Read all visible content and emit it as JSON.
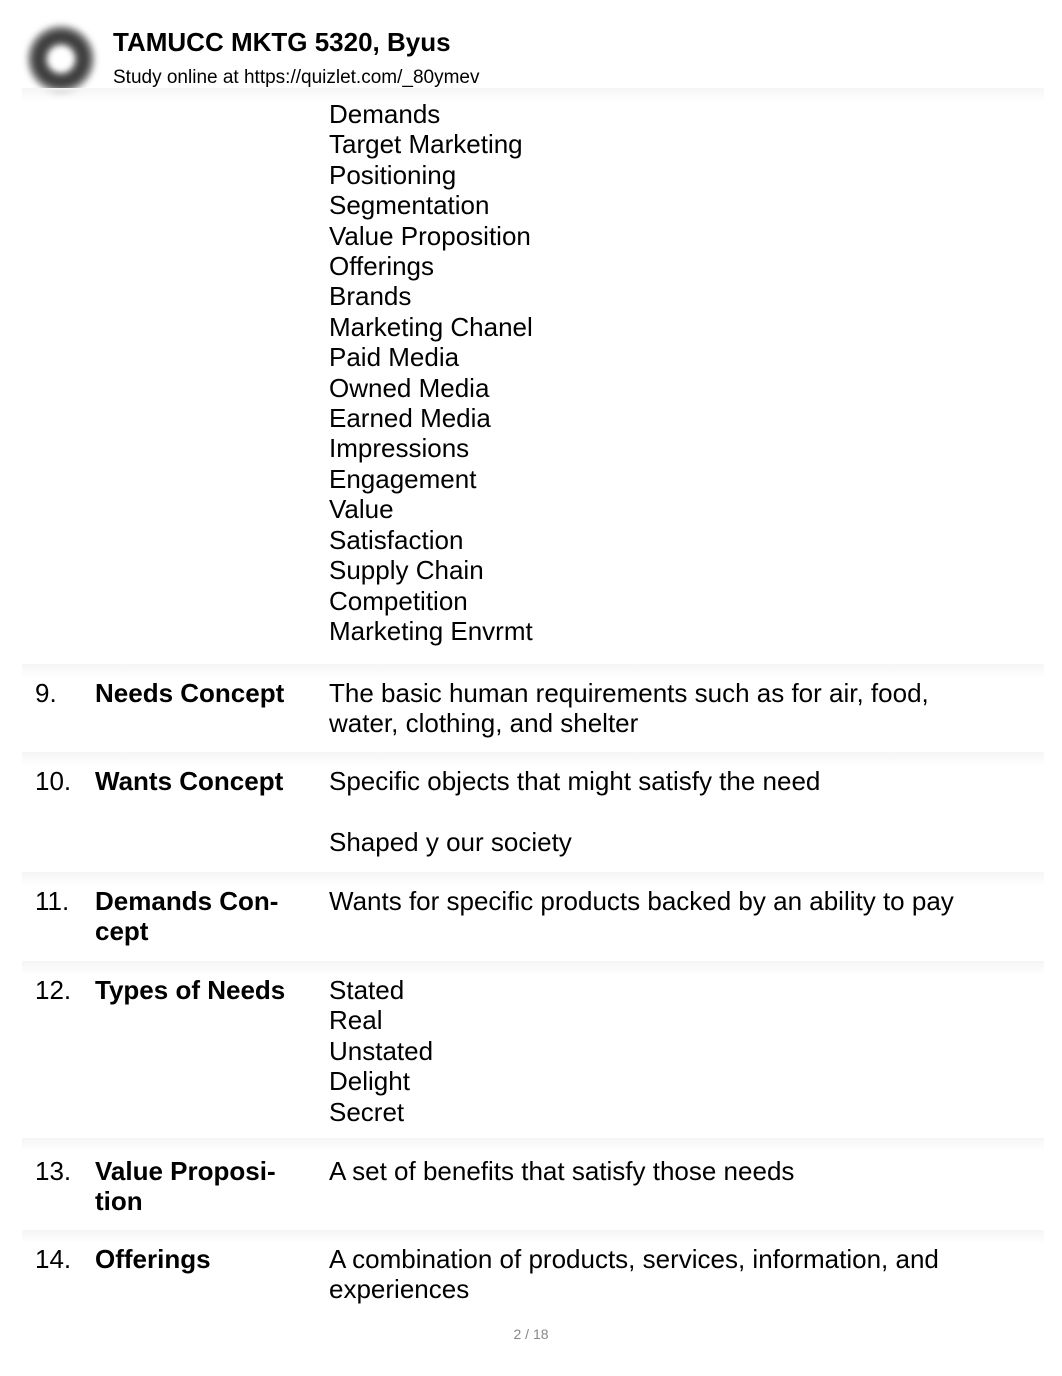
{
  "header": {
    "logo_icon": "quizlet-logo-icon",
    "title": "TAMUCC MKTG 5320, Byus",
    "subtitle": "Study online at https://quizlet.com/_80ymev"
  },
  "continued_definition": [
    "Demands",
    "Target Marketing",
    "Positioning",
    "Segmentation",
    "Value Proposition",
    "Offerings",
    "Brands",
    "Marketing Chanel",
    "Paid Media",
    "Owned Media",
    "Earned Media",
    "Impressions",
    "Engagement",
    "Value",
    "Satisfaction",
    "Supply Chain",
    "Competition",
    "Marketing Envrmt"
  ],
  "cards": [
    {
      "number": "9.",
      "term": "Needs Concept",
      "definition": [
        "The basic human requirements such as for air, food,",
        "water, clothing, and shelter"
      ]
    },
    {
      "number": "10.",
      "term": "Wants Concept",
      "definition": [
        "Specific objects that might satisfy the need",
        "",
        "Shaped y our society"
      ]
    },
    {
      "number": "11.",
      "term": "Demands Con-cept",
      "definition": [
        "Wants for specific products backed by an ability to pay"
      ]
    },
    {
      "number": "12.",
      "term": "Types of Needs",
      "definition": [
        "Stated",
        "Real",
        "Unstated",
        "Delight",
        "Secret"
      ]
    },
    {
      "number": "13.",
      "term": "Value Proposi-tion",
      "definition": [
        "A set of benefits that satisfy those needs"
      ]
    },
    {
      "number": "14.",
      "term": "Offerings",
      "definition": [
        "A combination of products, services, information, and",
        "experiences"
      ]
    }
  ],
  "footer": {
    "page_indicator": "2 / 18"
  }
}
